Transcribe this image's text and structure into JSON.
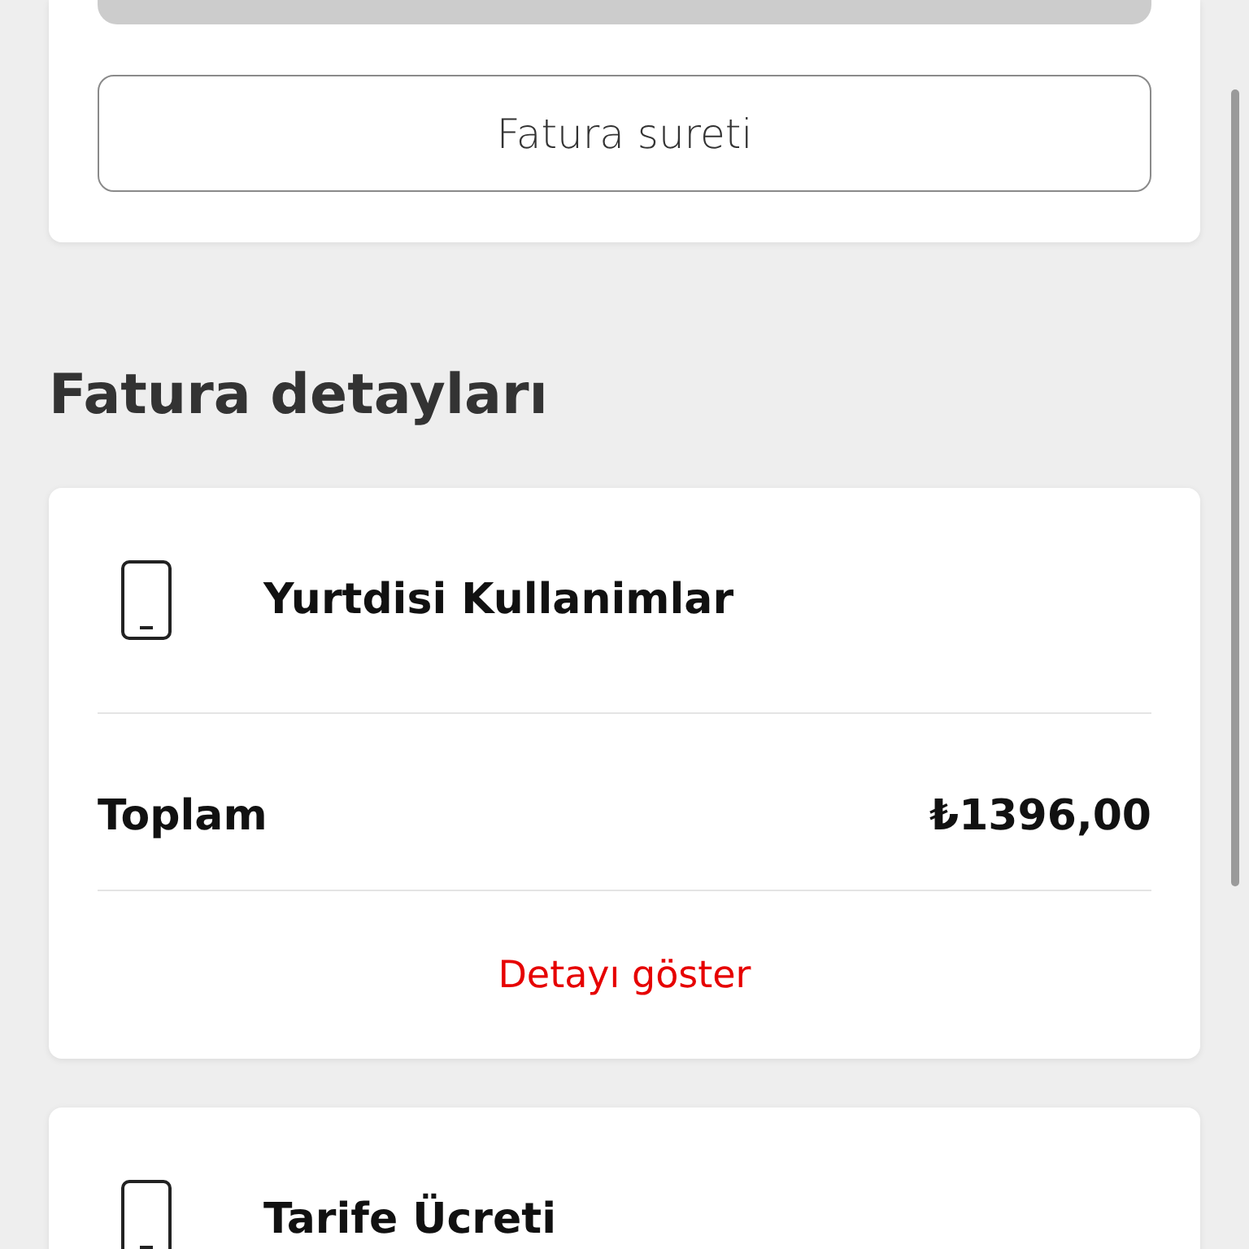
{
  "top_card": {
    "button": "Fatura sureti"
  },
  "section_title": "Fatura detayları",
  "detail_cards": [
    {
      "title": "Yurtdisi Kullanimlar",
      "total_label": "Toplam",
      "total_value": "₺1396,00",
      "link": "Detayı göster"
    },
    {
      "title": "Tarife Ücreti"
    }
  ]
}
